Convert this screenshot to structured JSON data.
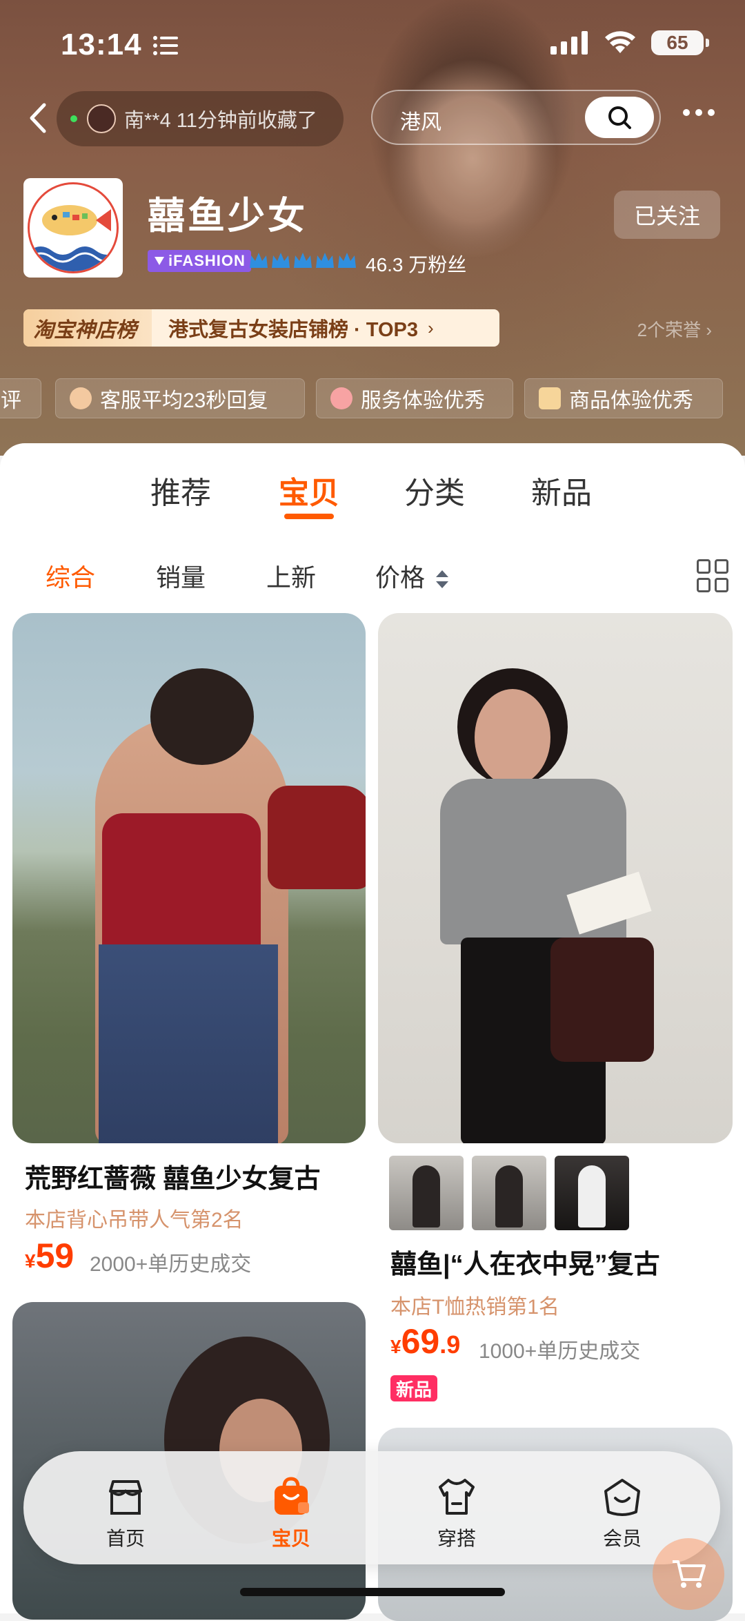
{
  "status": {
    "time": "13:14",
    "battery": "65"
  },
  "nav": {
    "notice": "南**4 11分钟前收藏了",
    "search_text": "港风"
  },
  "shop": {
    "name": "囍鱼少女",
    "badge": "iFASHION",
    "fans": "46.3 万粉丝",
    "follow_label": "已关注",
    "rank_label": "淘宝神店榜",
    "rank_text": "港式复古女装店铺榜 · TOP3",
    "honors": "2个荣誉",
    "services": [
      "评",
      "客服平均23秒回复",
      "服务体验优秀",
      "商品体验优秀"
    ]
  },
  "tabs": [
    "推荐",
    "宝贝",
    "分类",
    "新品"
  ],
  "sort": [
    "综合",
    "销量",
    "上新",
    "价格"
  ],
  "products": [
    {
      "title": "荒野红蔷薇 囍鱼少女复古",
      "tag": "本店背心吊带人气第2名",
      "price_int": "59",
      "price_dec": "",
      "sold": "2000+单历史成交"
    },
    {
      "title": "囍鱼|“人在衣中晃”复古",
      "tag": "本店T恤热销第1名",
      "price_int": "69",
      "price_dec": ".9",
      "sold": "1000+单历史成交",
      "badge": "新品"
    }
  ],
  "price_symbol": "¥",
  "bottom_nav": [
    "首页",
    "宝贝",
    "穿搭",
    "会员"
  ],
  "colors": {
    "accent": "#ff5a00",
    "price": "#ff3d00",
    "ifashion": "#8c5ae6"
  }
}
